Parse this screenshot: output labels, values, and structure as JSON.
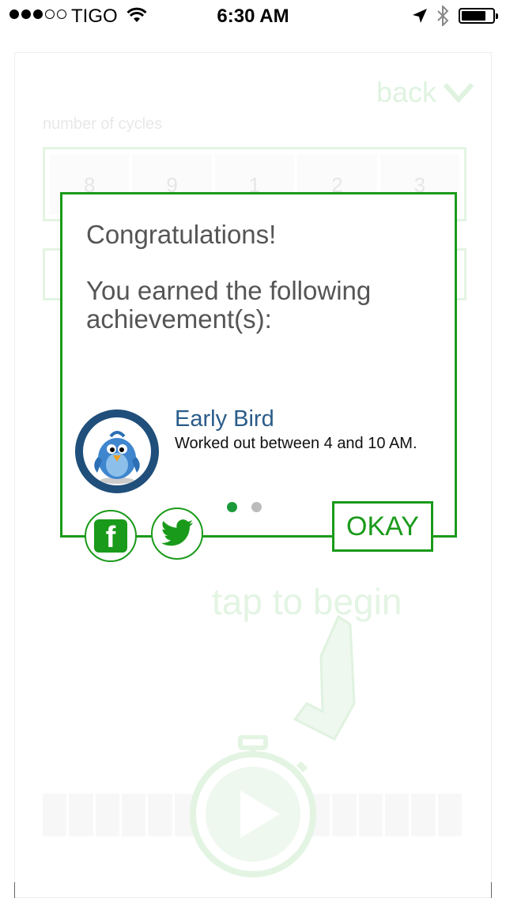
{
  "status_bar": {
    "carrier": "TIGO",
    "time": "6:30 AM",
    "signal_bars_filled": 3,
    "signal_bars_total": 5
  },
  "background_screen": {
    "back_label": "back",
    "cycles_label": "number of cycles",
    "picker_values": [
      "8",
      "9",
      "1",
      "2",
      "3"
    ],
    "tap_to_begin": "tap to begin"
  },
  "dialog": {
    "title": "Congratulations!",
    "message": "You earned the following achievement(s):",
    "achievement": {
      "name": "Early Bird",
      "description": "Worked out between 4 and 10 AM.",
      "icon": "bluebird-badge-icon"
    },
    "pager": {
      "count": 2,
      "active_index": 0
    },
    "okay_label": "OKAY"
  },
  "share": {
    "facebook_icon": "facebook-icon",
    "twitter_icon": "twitter-icon"
  },
  "colors": {
    "accent_green": "#1a9a1a",
    "badge_ring": "#1f4f7a",
    "achievement_title": "#2a5c8a",
    "faded_green": "#e3f4e3"
  }
}
